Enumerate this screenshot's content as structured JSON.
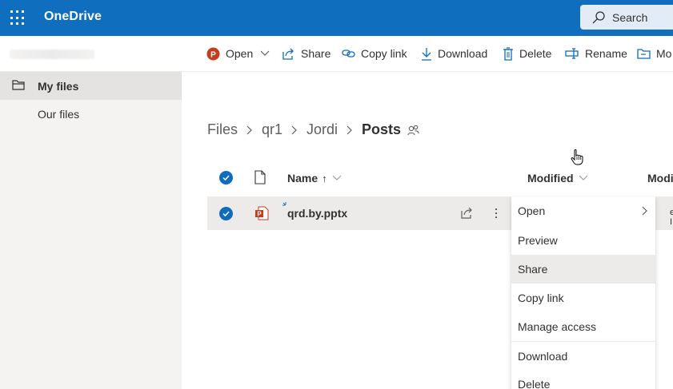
{
  "app": {
    "title": "OneDrive"
  },
  "search": {
    "placeholder": "Search"
  },
  "commandbar": {
    "open": "Open",
    "share": "Share",
    "copy_link": "Copy link",
    "download": "Download",
    "delete": "Delete",
    "rename": "Rename",
    "move_to_partial": "Mo"
  },
  "nav": {
    "items": [
      {
        "label": "My files",
        "icon": "folder-icon",
        "active": true
      },
      {
        "label": "Our files",
        "active": false
      }
    ]
  },
  "breadcrumb": {
    "items": [
      "Files",
      "qr1",
      "Jordi"
    ],
    "current": "Posts",
    "shared_icon": "people-icon"
  },
  "list": {
    "columns": {
      "name": "Name",
      "sort_arrow": "↑",
      "modified": "Modified",
      "modified_by_partial": "Modi"
    },
    "rows": [
      {
        "name": "qrd.by.pptx",
        "type": "pptx",
        "selected": true,
        "new": true,
        "modified_by_partial": "eter I"
      }
    ]
  },
  "context_menu": {
    "items": [
      {
        "label": "Open",
        "submenu": true
      },
      {
        "label": "Preview"
      },
      {
        "label": "Share",
        "highlighted": true
      },
      {
        "label": "Copy link"
      },
      {
        "label": "Manage access"
      },
      {
        "label": "Download"
      },
      {
        "label": "Delete"
      }
    ]
  },
  "colors": {
    "brand": "#106ebe",
    "check": "#0f6cbd",
    "pptx": "#c43e1c"
  }
}
